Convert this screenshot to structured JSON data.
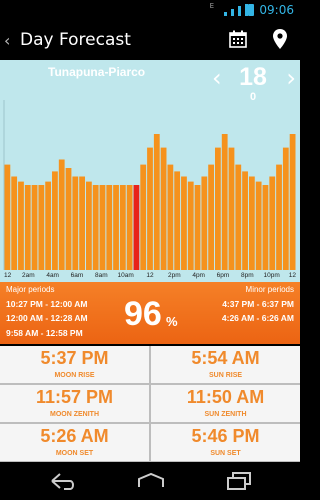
{
  "status_bar": {
    "network": "E",
    "time": "09:06"
  },
  "action_bar": {
    "title": "Day Forecast"
  },
  "location": {
    "name": "Tunapuna-Piarco"
  },
  "date_nav": {
    "day": "18",
    "sub": "0"
  },
  "chart_data": {
    "type": "bar",
    "x_tick_labels": [
      "12",
      "2am",
      "4am",
      "6am",
      "8am",
      "10am",
      "12",
      "2pm",
      "4pm",
      "6pm",
      "8pm",
      "10pm",
      "12"
    ],
    "values": [
      62,
      55,
      52,
      50,
      50,
      50,
      52,
      58,
      65,
      60,
      55,
      55,
      52,
      50,
      50,
      50,
      50,
      50,
      50,
      50,
      62,
      72,
      80,
      72,
      62,
      58,
      55,
      52,
      50,
      55,
      62,
      72,
      80,
      72,
      62,
      58,
      55,
      52,
      50,
      55,
      62,
      72,
      80
    ],
    "highlight_index": 19,
    "colors": {
      "bar": "#f5921d",
      "highlight": "#e8231a",
      "background": "#bfe7ec"
    }
  },
  "periods": {
    "major_title": "Major periods",
    "major": [
      "10:27 PM - 12:00 AM",
      "12:00 AM - 12:28 AM",
      "9:58 AM - 12:58 PM"
    ],
    "minor_title": "Minor periods",
    "minor": [
      "4:37 PM - 6:37 PM",
      "4:26 AM - 6:26 AM"
    ],
    "rating": "96",
    "rating_unit": "%"
  },
  "times": {
    "moon_rise": {
      "time": "5:37 PM",
      "label": "MOON RISE"
    },
    "sun_rise": {
      "time": "5:54 AM",
      "label": "SUN RISE"
    },
    "moon_zenith": {
      "time": "11:57 PM",
      "label": "MOON ZENITH"
    },
    "sun_zenith": {
      "time": "11:50 AM",
      "label": "SUN ZENITH"
    },
    "moon_set": {
      "time": "5:26 AM",
      "label": "MOON SET"
    },
    "sun_set": {
      "time": "5:46 PM",
      "label": "SUN SET"
    }
  },
  "colors": {
    "accent_orange": "#f08a2c",
    "android_blue": "#33b5e5"
  },
  "icons": [
    "calendar-icon",
    "location-pin-icon",
    "back-icon",
    "home-icon",
    "recent-apps-icon"
  ]
}
